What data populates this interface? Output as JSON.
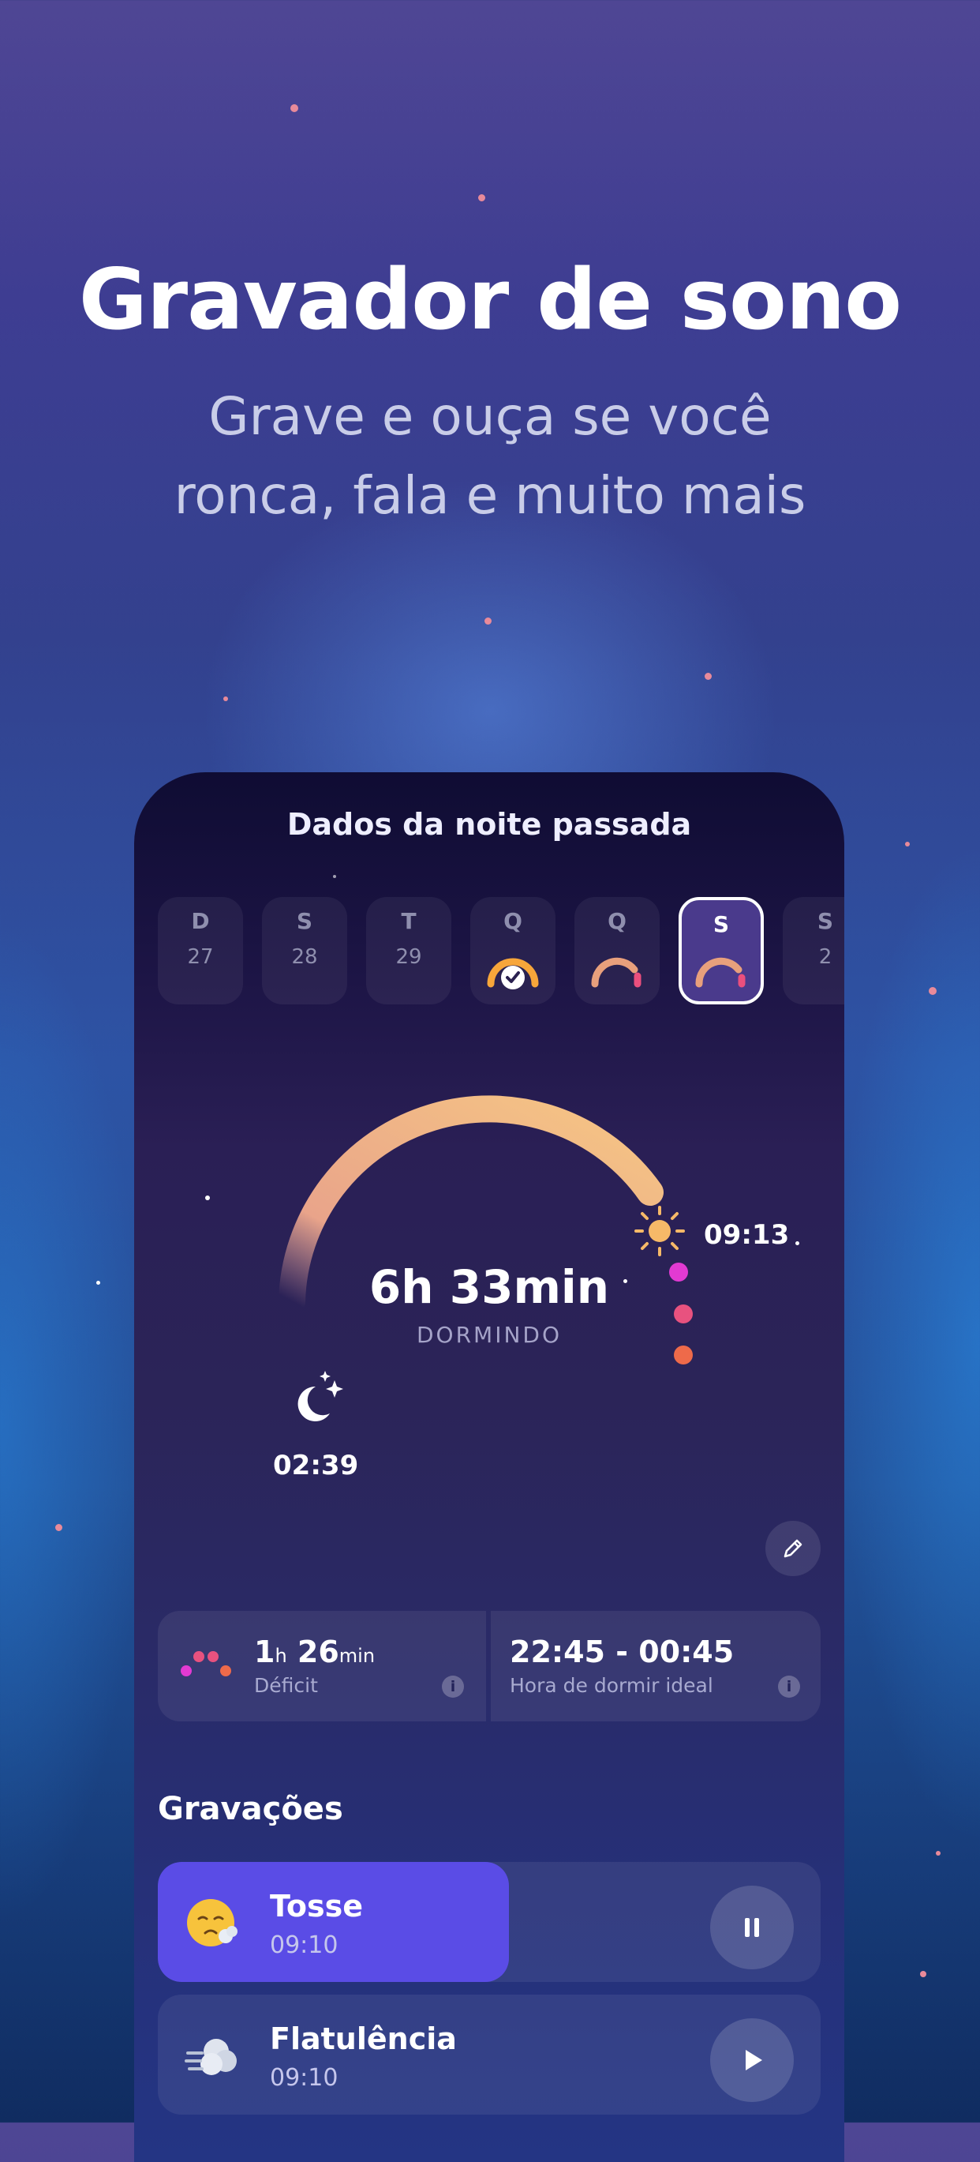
{
  "headline": "Gravador de sono",
  "subtitle": [
    "Grave e ouça se você",
    "ronca, fala e muito mais"
  ],
  "screen": {
    "title": "Dados da noite passada",
    "days": [
      {
        "letter": "D",
        "number": "27",
        "state": "empty"
      },
      {
        "letter": "S",
        "number": "28",
        "state": "empty"
      },
      {
        "letter": "T",
        "number": "29",
        "state": "empty"
      },
      {
        "letter": "Q",
        "number": "",
        "state": "goal-met-icon"
      },
      {
        "letter": "Q",
        "number": "",
        "state": "arc-icon"
      },
      {
        "letter": "S",
        "number": "",
        "state": "arc-icon-selected"
      },
      {
        "letter": "S",
        "number": "2",
        "state": "empty"
      }
    ],
    "sleep": {
      "duration": "6h 33min",
      "label": "DORMINDO",
      "start": "02:39",
      "end": "09:13"
    },
    "deficit": {
      "hours": "1",
      "h_unit": "h",
      "minutes": "26",
      "min_unit": "min",
      "label": "Déficit"
    },
    "ideal": {
      "value": "22:45 - 00:45",
      "label": "Hora de dormir ideal"
    },
    "recordings_title": "Gravações",
    "recordings": [
      {
        "name": "Tosse",
        "time": "09:10",
        "state": "playing",
        "progress": 0.53,
        "icon": "coughing-face-icon"
      },
      {
        "name": "Flatulência",
        "time": "09:10",
        "state": "paused",
        "progress": 0,
        "icon": "gas-cloud-icon"
      }
    ]
  },
  "colors": {
    "accent": "#5a4ce6",
    "arc_start": "#e9a87a",
    "arc_end": "#f6c27f",
    "dot_pink": "#e23ad2",
    "dot_rose": "#e8527f",
    "dot_orange": "#ee6a4a"
  }
}
